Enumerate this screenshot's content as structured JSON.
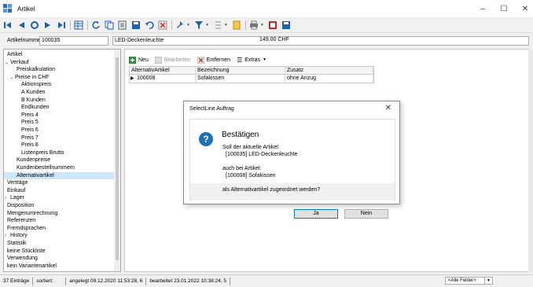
{
  "window": {
    "title": "Artikel",
    "minimize": "–",
    "maximize": "☐",
    "close": "✕"
  },
  "toolbar": {
    "icons": [
      "first-record-icon",
      "prev-record-icon",
      "refresh-icon",
      "next-record-icon",
      "last-record-icon",
      "grid-icon",
      "reload-icon",
      "copy-icon",
      "edit-icon",
      "save-icon",
      "undo-icon",
      "delete-icon",
      "pin-icon",
      "filter-icon",
      "sort-icon",
      "link-icon",
      "print-icon",
      "pdf-icon",
      "calculator-icon"
    ]
  },
  "article": {
    "number_label": "Artikelnummer",
    "number": "100035",
    "name": "LED-Deckenleuchte",
    "price": "149.00  CHF"
  },
  "tree": [
    {
      "label": "Artikel",
      "level": 0
    },
    {
      "label": "Verkauf",
      "level": 0,
      "caret": "v"
    },
    {
      "label": "Preiskalkulation",
      "level": 2
    },
    {
      "label": "Preise in CHF",
      "level": 1,
      "caret": "v"
    },
    {
      "label": "Aktionspreis",
      "level": 3
    },
    {
      "label": "A Kunden",
      "level": 3
    },
    {
      "label": "B Kunden",
      "level": 3
    },
    {
      "label": "Endkunden",
      "level": 3
    },
    {
      "label": "Preis 4",
      "level": 3
    },
    {
      "label": "Preis 5",
      "level": 3
    },
    {
      "label": "Preis 6",
      "level": 3
    },
    {
      "label": "Preis 7",
      "level": 3
    },
    {
      "label": "Preis 8",
      "level": 3
    },
    {
      "label": "Listenpreis Brutto",
      "level": 3
    },
    {
      "label": "Kundenpreise",
      "level": 2
    },
    {
      "label": "Kundenbestellnummern",
      "level": 2
    },
    {
      "label": "Alternativartikel",
      "level": 2,
      "selected": true
    },
    {
      "label": "Verträge",
      "level": 0
    },
    {
      "label": "Einkauf",
      "level": 0
    },
    {
      "label": "Lager",
      "level": 0,
      "caret": ">"
    },
    {
      "label": "Disposition",
      "level": 0
    },
    {
      "label": "Mengenumrechnung",
      "level": 0
    },
    {
      "label": "Referenzen",
      "level": 0
    },
    {
      "label": "Fremdsprachen",
      "level": 0
    },
    {
      "label": "History",
      "level": 0,
      "caret": ">"
    },
    {
      "label": "Statistik",
      "level": 0
    },
    {
      "label": "keine Stückliste",
      "level": 0
    },
    {
      "label": "Verwendung",
      "level": 0
    },
    {
      "label": "kein Variantenartikel",
      "level": 0
    }
  ],
  "subtoolbar": {
    "new": "Neu",
    "edit": "Bearbeiten",
    "remove": "Entfernen",
    "extras": "Extras"
  },
  "grid": {
    "columns": [
      "AlternativArtikel",
      "Bezeichnung",
      "Zusatz"
    ],
    "row": [
      "100008",
      "Sofakissen",
      "ohne Anzug"
    ]
  },
  "dialog": {
    "title": "SelectLine Auftrag",
    "heading": "Bestätigen",
    "lines": [
      "Soll der aktuelle Artikel:",
      "[100035] LED-Deckenleuchte",
      "auch bei Artikel:",
      "[100008] Sofakissen",
      "als Alternativartikel zugeordnet werden?"
    ],
    "yes": "Ja",
    "no": "Nein"
  },
  "status": {
    "count": "37 Einträge",
    "sorted": "sortiert:",
    "created": "angelegt 09.12.2020 11:53:28,  6",
    "edited": "bearbeitet 23.01.2022 10:38:24,  5",
    "fields": "<Alle Felder>"
  },
  "colors": {
    "selection": "#cce8ff",
    "accent": "#0078d7",
    "question_icon": "#1e6fb8"
  }
}
